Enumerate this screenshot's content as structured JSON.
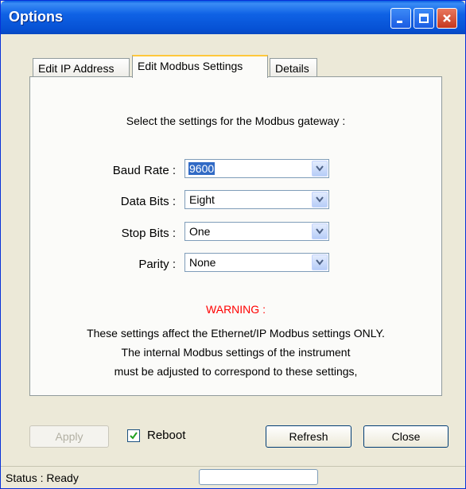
{
  "window": {
    "title": "Options",
    "colors": {
      "titlebar": "#0a5fe3",
      "close_button": "#c5371f",
      "accent_tab": "#ffc83c",
      "warning": "#ff0000"
    }
  },
  "tabs": [
    {
      "label": "Edit IP Address",
      "active": false
    },
    {
      "label": "Edit Modbus Settings",
      "active": true
    },
    {
      "label": "Details",
      "active": false
    }
  ],
  "panel": {
    "intro": "Select the settings for the Modbus gateway :",
    "fields": [
      {
        "label": "Baud Rate :",
        "value": "9600"
      },
      {
        "label": "Data Bits :",
        "value": "Eight"
      },
      {
        "label": "Stop Bits :",
        "value": "One"
      },
      {
        "label": "Parity :",
        "value": "None"
      }
    ],
    "warning": "WARNING :",
    "notes": [
      "These settings affect the Ethernet/IP Modbus settings ONLY.",
      "The internal Modbus settings of the instrument",
      "must be adjusted to correspond to these settings,"
    ]
  },
  "buttons": {
    "apply": "Apply",
    "reboot_label": "Reboot",
    "reboot_checked": true,
    "refresh": "Refresh",
    "close": "Close"
  },
  "status": {
    "text": "Status : Ready",
    "field_value": ""
  },
  "icons": [
    "minimize-icon",
    "maximize-icon",
    "close-icon",
    "chevron-down-icon",
    "checkmark-icon"
  ]
}
